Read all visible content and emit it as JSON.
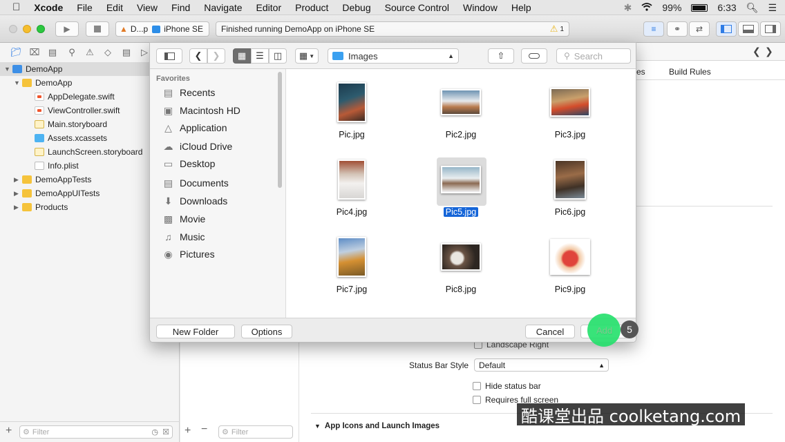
{
  "menubar": {
    "apple": "",
    "app": "Xcode",
    "items": [
      "File",
      "Edit",
      "View",
      "Find",
      "Navigate",
      "Editor",
      "Product",
      "Debug",
      "Source Control",
      "Window",
      "Help"
    ],
    "battery": "99%",
    "time": "6:33"
  },
  "toolbar": {
    "scheme": "D...p",
    "device": "iPhone SE",
    "status": "Finished running DemoApp on iPhone SE",
    "warnings": "1"
  },
  "navigator": {
    "tree": [
      {
        "label": "DemoApp",
        "type": "proj"
      },
      {
        "label": "DemoApp",
        "type": "folder"
      },
      {
        "label": "AppDelegate.swift",
        "type": "swift"
      },
      {
        "label": "ViewController.swift",
        "type": "swift"
      },
      {
        "label": "Main.storyboard",
        "type": "sb"
      },
      {
        "label": "Assets.xcassets",
        "type": "xc"
      },
      {
        "label": "LaunchScreen.storyboard",
        "type": "sb"
      },
      {
        "label": "Info.plist",
        "type": "pl"
      },
      {
        "label": "DemoAppTests",
        "type": "folder"
      },
      {
        "label": "DemoAppUITests",
        "type": "folder"
      },
      {
        "label": "Products",
        "type": "folder"
      }
    ],
    "filter_placeholder": "Filter"
  },
  "editor": {
    "tab_partial": "es",
    "tab_build_rules": "Build Rules",
    "landscape_right": "Landscape Right",
    "status_bar_label": "Status Bar Style",
    "status_bar_value": "Default",
    "hide_status_bar": "Hide status bar",
    "requires_full_screen": "Requires full screen",
    "section": "App Icons and Launch Images",
    "filter_placeholder": "Filter"
  },
  "dialog": {
    "location": "Images",
    "search_placeholder": "Search",
    "favorites_header": "Favorites",
    "favorites": [
      {
        "label": "Recents",
        "icon": "recents-icon"
      },
      {
        "label": "Macintosh HD",
        "icon": "disk-icon"
      },
      {
        "label": "Application",
        "icon": "applications-icon"
      },
      {
        "label": "iCloud Drive",
        "icon": "cloud-icon"
      },
      {
        "label": "Desktop",
        "icon": "desktop-icon"
      },
      {
        "label": "Documents",
        "icon": "documents-icon"
      },
      {
        "label": "Downloads",
        "icon": "downloads-icon"
      },
      {
        "label": "Movie",
        "icon": "movie-icon"
      },
      {
        "label": "Music",
        "icon": "music-icon"
      },
      {
        "label": "Pictures",
        "icon": "camera-icon"
      }
    ],
    "files": [
      "Pic.jpg",
      "Pic2.jpg",
      "Pic3.jpg",
      "Pic4.jpg",
      "Pic5.jpg",
      "Pic6.jpg",
      "Pic7.jpg",
      "Pic8.jpg",
      "Pic9.jpg"
    ],
    "selected": "Pic5.jpg",
    "new_folder": "New Folder",
    "options": "Options",
    "cancel": "Cancel",
    "add": "Add",
    "step_badge": "5"
  },
  "watermark": "酷课堂出品 coolketang.com",
  "colors": {
    "accent": "#1565d8",
    "highlight": "#22e06a",
    "folder": "#f5c33b"
  }
}
